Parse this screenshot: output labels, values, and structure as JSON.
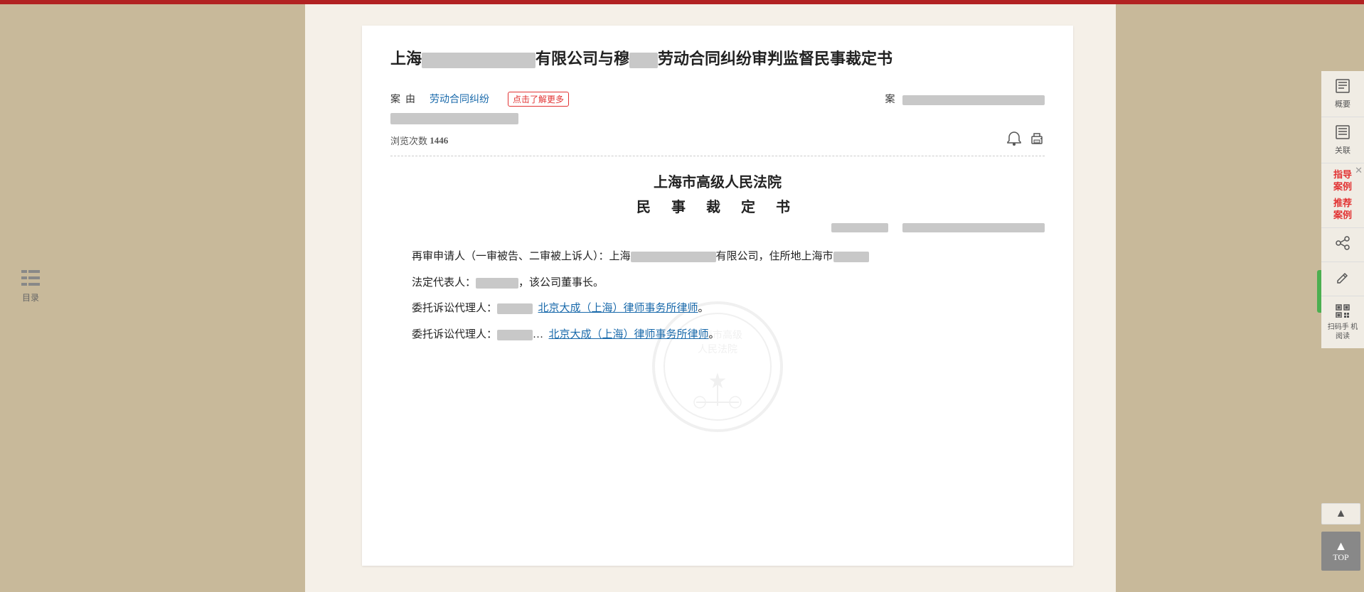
{
  "topbar": {
    "color": "#b22222"
  },
  "document": {
    "title_prefix": "上海",
    "title_blur1": "████████",
    "title_mid": "有限公司与穆",
    "title_blur2": "██",
    "title_suffix": "劳动合同纠纷审判监督民事裁定书",
    "case_label": "案",
    "case_by_label": "由",
    "case_type": "劳动合同纠纷",
    "more_btn": "点击了解更多",
    "case_num_label": "案",
    "view_count_label": "浏览次数",
    "view_count": "1446",
    "court_name": "上海市高级人民法院",
    "doc_type": "民 事 裁 定 书",
    "body": [
      {
        "id": "p1",
        "indent": true,
        "text": "再审申请人（一审被告、二审被上诉人）：上海",
        "blur": "████████████",
        "text2": "有限公司，住所地上海市",
        "blur2": "████"
      },
      {
        "id": "p2",
        "indent": true,
        "text": "法定代表人：",
        "blur": "██████",
        "text2": "，该公司董事长。"
      },
      {
        "id": "p3",
        "indent": true,
        "text": "委托诉讼代理人：",
        "blur": "████",
        "text2": "，",
        "link": "北京大成（上海）律师事务所律师",
        "text3": "。"
      },
      {
        "id": "p4",
        "indent": true,
        "text": "委托诉讼代理人：",
        "blur": "████",
        "text2": "…",
        "link2": "北京大成（上海）律师事务所律师",
        "text3": "。"
      }
    ]
  },
  "sidebar": {
    "summary_label": "概要",
    "related_label": "关联",
    "guide_case_label": "指导\n案例",
    "recommend_case_label": "推荐\n案例",
    "share_label": "",
    "edit_label": "",
    "scan_label": "扫码手\n机阅读"
  },
  "toc": {
    "label": "目录"
  },
  "top_button": {
    "arrow": "▲",
    "label": "TOP"
  },
  "scroll_up": {
    "label": "▲"
  }
}
